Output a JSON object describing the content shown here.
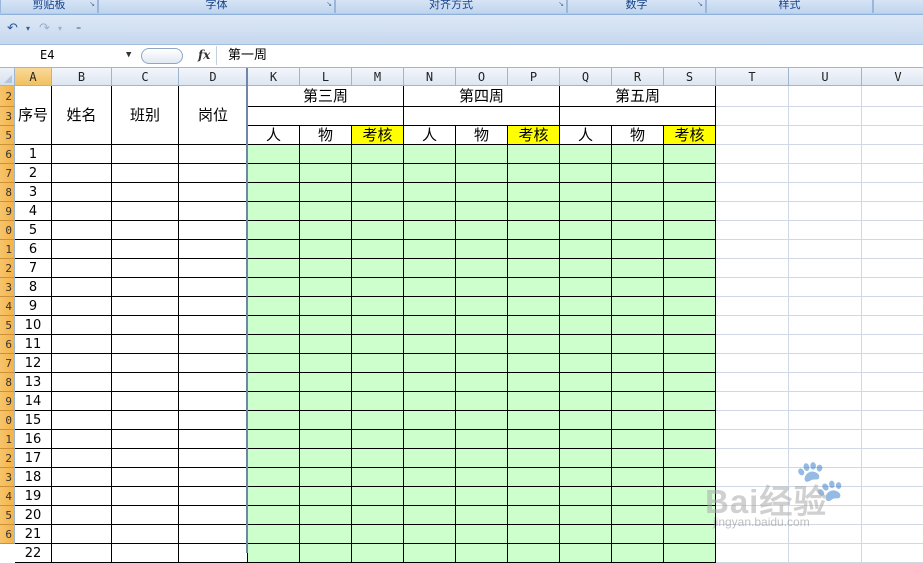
{
  "ribbon": {
    "groups": [
      "剪贴板",
      "字体",
      "对齐方式",
      "数字",
      "样式"
    ]
  },
  "qat": {
    "undo_icon": "undo-icon",
    "redo_icon": "redo-icon",
    "customize_icon": "customize-icon"
  },
  "formula_bar": {
    "name_box": "E4",
    "fx_label": "fx",
    "content": "第一周"
  },
  "columns": [
    "A",
    "B",
    "C",
    "D",
    "K",
    "L",
    "M",
    "N",
    "O",
    "P",
    "Q",
    "R",
    "S",
    "T",
    "U",
    "V"
  ],
  "selected_column": "A",
  "row_headers": [
    "2",
    "3",
    "5",
    "6",
    "7",
    "8",
    "9",
    "0",
    "1",
    "2",
    "3",
    "4",
    "5",
    "6",
    "7",
    "8",
    "9",
    "0",
    "1",
    "2",
    "3",
    "4",
    "5",
    "6"
  ],
  "headers": {
    "xuhao": "序号",
    "xingming": "姓名",
    "banbie": "班别",
    "gangwei": "岗位",
    "week3": "第三周",
    "week4": "第四周",
    "week5": "第五周",
    "ren": "人",
    "wu": "物",
    "kaohe": "考核"
  },
  "serials": [
    "1",
    "2",
    "3",
    "4",
    "5",
    "6",
    "7",
    "8",
    "9",
    "10",
    "11",
    "12",
    "13",
    "14",
    "15",
    "16",
    "17",
    "18",
    "19",
    "20",
    "21",
    "22"
  ],
  "colors": {
    "accent_fill": "#ccffcc",
    "highlight": "#ffff00",
    "selected_header": "#f4b34a"
  },
  "watermark": {
    "brand": "Bai经验",
    "sub": "jingyan.baidu.com"
  }
}
